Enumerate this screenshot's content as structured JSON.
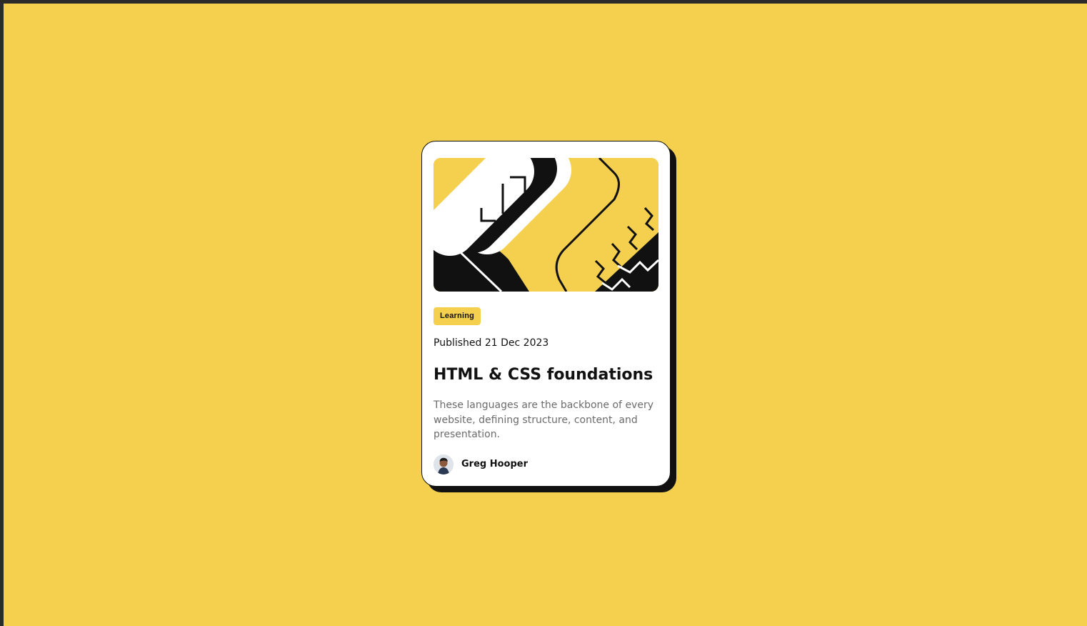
{
  "card": {
    "tag": "Learning",
    "published": "Published 21 Dec 2023",
    "title": "HTML & CSS foundations",
    "description": "These languages are the backbone of every website, defining structure, content, and presentation.",
    "author": {
      "name": "Greg Hooper",
      "avatar_icon": "person-avatar-icon"
    },
    "illustration_icon": "abstract-illustration-icon"
  },
  "colors": {
    "background": "#f4d04e",
    "card": "#ffffff",
    "text": "#111111",
    "muted_text": "#6b6b6b",
    "frame": "#2b2b2b"
  }
}
